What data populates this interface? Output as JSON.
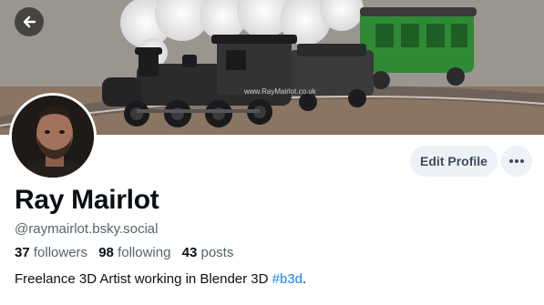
{
  "banner": {
    "watermark": "www.RayMairlot.co.uk",
    "colors": {
      "engine": "#2b2b2d",
      "carriage": "#2f8a35",
      "smoke": "#eeeeee",
      "table": "#8a7562"
    }
  },
  "navigation": {
    "back_icon": "arrow-left-icon"
  },
  "profile": {
    "display_name": "Ray Mairlot",
    "handle": "@raymairlot.bsky.social",
    "stats": {
      "followers_count": "37",
      "followers_label": "followers",
      "following_count": "98",
      "following_label": "following",
      "posts_count": "43",
      "posts_label": "posts"
    },
    "bio_text": "Freelance 3D Artist working in Blender 3D ",
    "bio_hashtag": "#b3d",
    "bio_end": "."
  },
  "actions": {
    "edit_profile_label": "Edit Profile",
    "more_icon": "ellipsis-icon"
  },
  "colors": {
    "accent_link": "#1083fe",
    "button_bg": "#eef2f7",
    "muted_text": "#56626f"
  }
}
